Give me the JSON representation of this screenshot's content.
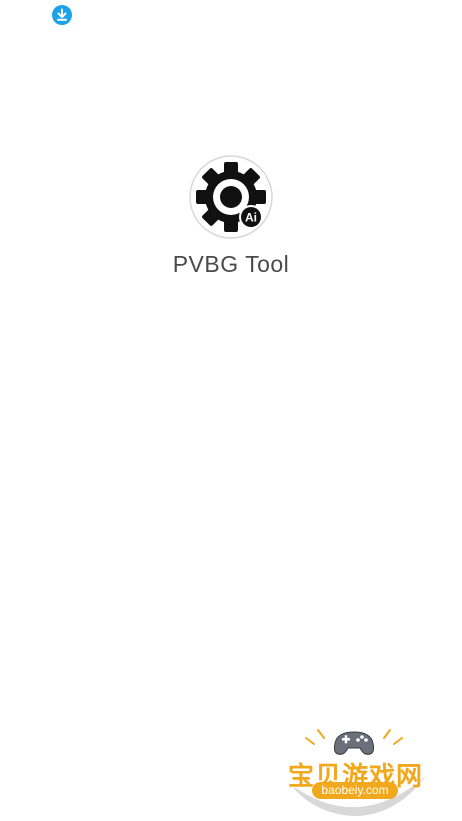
{
  "status_bar": {
    "download_icon": "download-icon",
    "download_color": "#1aa3e8"
  },
  "splash": {
    "app_icon": "gear-ai-icon",
    "app_icon_badge": "Ai",
    "app_name": "PVBG Tool"
  },
  "watermark": {
    "logo_icon": "gamepad-icon",
    "title": "宝贝游戏网",
    "url": "baobeiy.com",
    "accent_color": "#f2a81d"
  }
}
